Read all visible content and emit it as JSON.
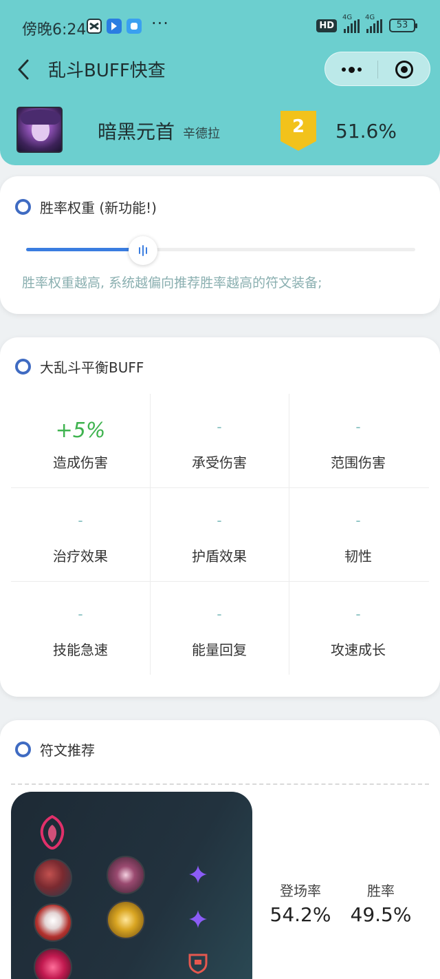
{
  "status_bar": {
    "time": "傍晚6:24",
    "more": "···",
    "hd": "HD",
    "network_1": "4G",
    "network_2": "4G",
    "battery": "53"
  },
  "nav": {
    "title": "乱斗BUFF快查"
  },
  "champion": {
    "name": "暗黑元首",
    "subtitle": "辛德拉",
    "tier": "2",
    "win_rate": "51.6%"
  },
  "winrate_weight": {
    "title": "胜率权重 (新功能!)",
    "slider_level_percent": 30,
    "hint": "胜率权重越高, 系统越偏向推荐胜率越高的符文装备;"
  },
  "balance_buff": {
    "title": "大乱斗平衡BUFF",
    "items": [
      {
        "value": "+5%",
        "label": "造成伤害",
        "positive": true
      },
      {
        "value": "-",
        "label": "承受伤害",
        "positive": false
      },
      {
        "value": "-",
        "label": "范围伤害",
        "positive": false
      },
      {
        "value": "-",
        "label": "治疗效果",
        "positive": false
      },
      {
        "value": "-",
        "label": "护盾效果",
        "positive": false
      },
      {
        "value": "-",
        "label": "韧性",
        "positive": false
      },
      {
        "value": "-",
        "label": "技能急速",
        "positive": false
      },
      {
        "value": "-",
        "label": "能量回复",
        "positive": false
      },
      {
        "value": "-",
        "label": "攻速成长",
        "positive": false
      }
    ]
  },
  "rune_recommend": {
    "title": "符文推荐",
    "pick_rate_label": "登场率",
    "pick_rate": "54.2%",
    "win_rate_label": "胜率",
    "win_rate": "49.5%",
    "icons": [
      "domination-keystone-icon",
      "rune-icon",
      "rune-icon",
      "rune-icon",
      "rune-icon",
      "rune-icon",
      "adaptive-force-shard-icon",
      "adaptive-force-shard-icon",
      "armor-shard-icon"
    ]
  },
  "colors": {
    "header": "#6ccfcf",
    "accent": "#3f6bc2",
    "slider": "#3a7de0",
    "positive": "#3fb34f",
    "muted": "#7fbcbc",
    "tier": "#f2c21b"
  }
}
